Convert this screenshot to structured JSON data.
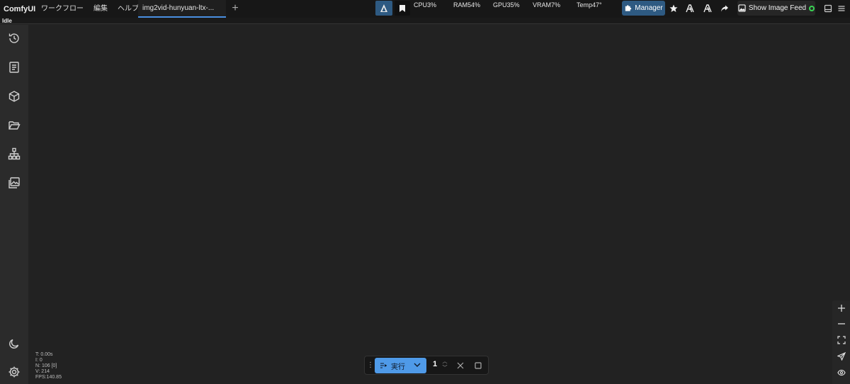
{
  "app": {
    "name": "ComfyUI"
  },
  "menu": [
    {
      "key": "workflow",
      "label": "ワークフロー"
    },
    {
      "key": "edit",
      "label": "編集"
    },
    {
      "key": "help",
      "label": "ヘルプ"
    }
  ],
  "tabs": [
    {
      "label": "img2vid-hunyuan-ltx-..."
    }
  ],
  "tab_add_icon": "plus-icon",
  "monitor": {
    "cpu": "CPU3%",
    "ram": "RAM54%",
    "gpu": "GPU35%",
    "vram": "VRAM7%",
    "temp": "Temp47°"
  },
  "toolbar": {
    "manager_label": "Manager",
    "feed_label": "Show Image Feed",
    "accent": "#2e5a82",
    "feed_indicator_color": "#39d353"
  },
  "status": {
    "text": "Idle"
  },
  "sidebar_icons": [
    "history-icon",
    "notebook-icon",
    "cube-icon",
    "folder-icon",
    "workflow-tree-icon",
    "image-gallery-icon"
  ],
  "sidebar_bottom_icons": [
    "moon-icon",
    "gear-icon"
  ],
  "stats": {
    "t": "T: 0.00s",
    "i": "I: 0",
    "n": "N: 106 [0]",
    "v": "V: 214",
    "fps": "FPS:140.85"
  },
  "run_panel": {
    "run_label": "実行",
    "queue_count": "1",
    "run_color": "#4f9ae8"
  },
  "zoom_controls": [
    "plus-icon",
    "minus-icon",
    "fit-view-icon",
    "send-icon",
    "eye-icon"
  ]
}
